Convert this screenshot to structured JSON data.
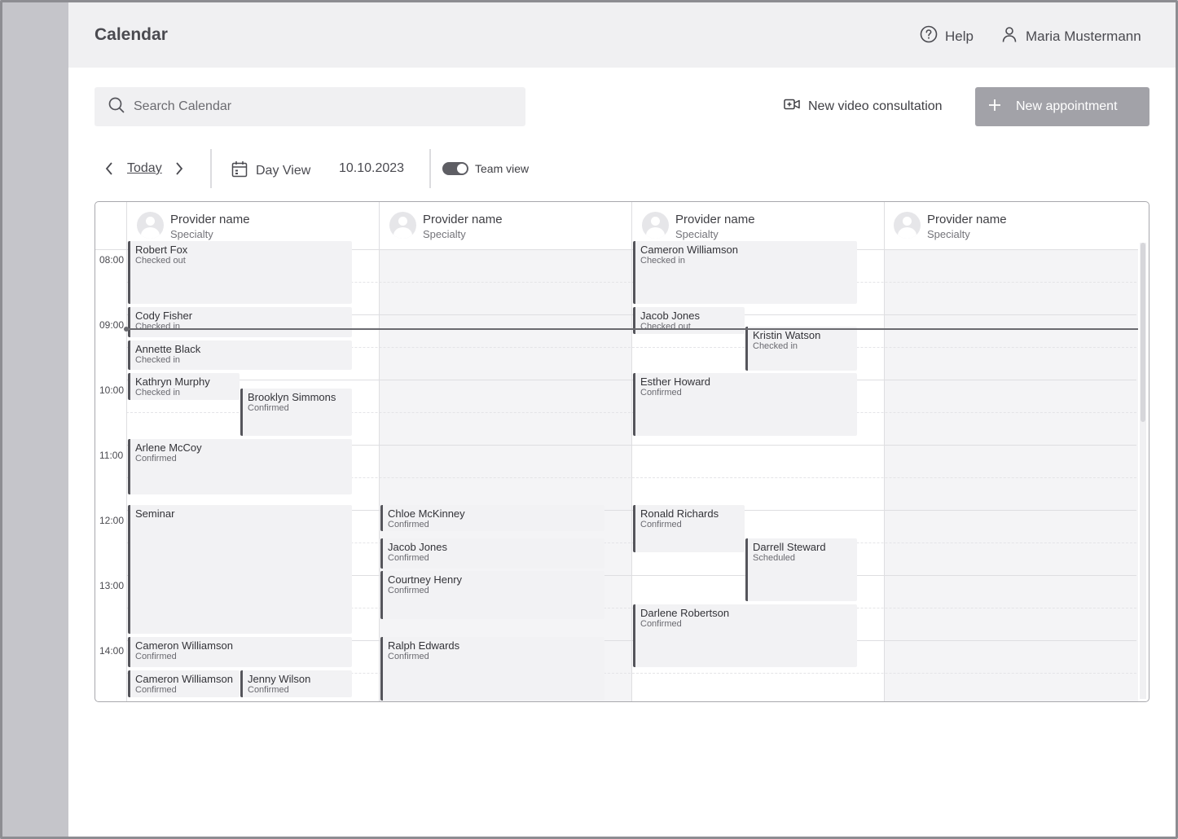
{
  "header": {
    "title": "Calendar",
    "help_label": "Help",
    "user_name": "Maria Mustermann"
  },
  "search": {
    "placeholder": "Search Calendar"
  },
  "actions": {
    "video_label": "New video consultation",
    "new_appointment_label": "New appointment"
  },
  "toolbar": {
    "today_label": "Today",
    "view_label": "Day View",
    "date": "10.10.2023",
    "team_view_label": "Team view",
    "team_view_on": true
  },
  "times": [
    "08:00",
    "09:00",
    "10:00",
    "11:00",
    "12:00",
    "13:00",
    "14:00"
  ],
  "providers": [
    {
      "name": "Provider name",
      "specialty": "Specialty"
    },
    {
      "name": "Provider name",
      "specialty": "Specialty"
    },
    {
      "name": "Provider name",
      "specialty": "Specialty"
    },
    {
      "name": "Provider name",
      "specialty": "Specialty"
    }
  ],
  "appointments": [
    {
      "name": "Robert Fox",
      "status": "Checked out"
    },
    {
      "name": "Cody Fisher",
      "status": "Checked in"
    },
    {
      "name": "Annette Black",
      "status": "Checked in"
    },
    {
      "name": "Kathryn Murphy",
      "status": "Checked in"
    },
    {
      "name": "Brooklyn Simmons",
      "status": "Confirmed"
    },
    {
      "name": "Arlene McCoy",
      "status": "Confirmed"
    },
    {
      "name": "Seminar",
      "status": ""
    },
    {
      "name": "Cameron Williamson",
      "status": "Confirmed"
    },
    {
      "name": "Cameron Williamson",
      "status": "Confirmed"
    },
    {
      "name": "Jenny Wilson",
      "status": "Confirmed"
    },
    {
      "name": "Chloe McKinney",
      "status": "Confirmed"
    },
    {
      "name": "Jacob Jones",
      "status": "Confirmed"
    },
    {
      "name": "Courtney Henry",
      "status": "Confirmed"
    },
    {
      "name": "Ralph Edwards",
      "status": "Confirmed"
    },
    {
      "name": "Cameron Williamson",
      "status": "Checked in"
    },
    {
      "name": "Jacob Jones",
      "status": "Checked out"
    },
    {
      "name": "Kristin Watson",
      "status": "Checked in"
    },
    {
      "name": "Esther Howard",
      "status": "Confirmed"
    },
    {
      "name": "Ronald Richards",
      "status": "Confirmed"
    },
    {
      "name": "Darrell Steward",
      "status": "Scheduled"
    },
    {
      "name": "Darlene Robertson",
      "status": "Confirmed"
    }
  ]
}
